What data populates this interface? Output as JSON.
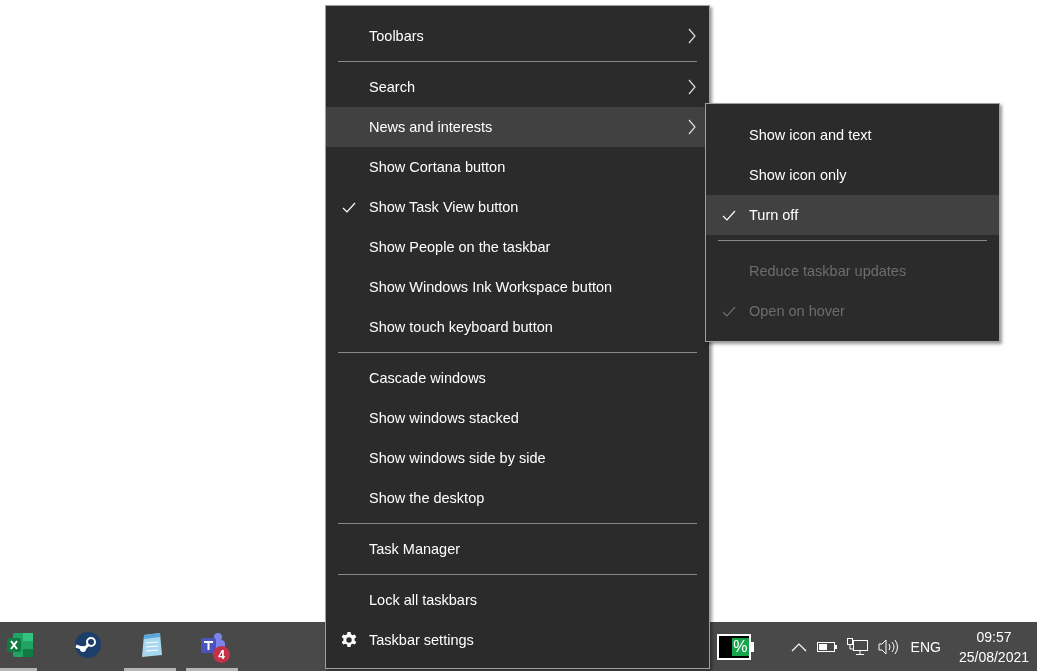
{
  "context_menu": {
    "items": [
      {
        "kind": "item",
        "label": "Toolbars",
        "submenu": true,
        "checked": false,
        "selected": false
      },
      {
        "kind": "separator"
      },
      {
        "kind": "item",
        "label": "Search",
        "submenu": true,
        "checked": false,
        "selected": false
      },
      {
        "kind": "item",
        "label": "News and interests",
        "submenu": true,
        "checked": false,
        "selected": true
      },
      {
        "kind": "item",
        "label": "Show Cortana button",
        "submenu": false,
        "checked": false,
        "selected": false
      },
      {
        "kind": "item",
        "label": "Show Task View button",
        "submenu": false,
        "checked": true,
        "selected": false
      },
      {
        "kind": "item",
        "label": "Show People on the taskbar",
        "submenu": false,
        "checked": false,
        "selected": false
      },
      {
        "kind": "item",
        "label": "Show Windows Ink Workspace button",
        "submenu": false,
        "checked": false,
        "selected": false
      },
      {
        "kind": "item",
        "label": "Show touch keyboard button",
        "submenu": false,
        "checked": false,
        "selected": false
      },
      {
        "kind": "separator"
      },
      {
        "kind": "item",
        "label": "Cascade windows",
        "submenu": false,
        "checked": false,
        "selected": false
      },
      {
        "kind": "item",
        "label": "Show windows stacked",
        "submenu": false,
        "checked": false,
        "selected": false
      },
      {
        "kind": "item",
        "label": "Show windows side by side",
        "submenu": false,
        "checked": false,
        "selected": false
      },
      {
        "kind": "item",
        "label": "Show the desktop",
        "submenu": false,
        "checked": false,
        "selected": false
      },
      {
        "kind": "separator"
      },
      {
        "kind": "item",
        "label": "Task Manager",
        "submenu": false,
        "checked": false,
        "selected": false
      },
      {
        "kind": "separator"
      },
      {
        "kind": "item",
        "label": "Lock all taskbars",
        "submenu": false,
        "checked": false,
        "selected": false
      },
      {
        "kind": "settings",
        "label": "Taskbar settings",
        "submenu": false,
        "selected": false
      }
    ]
  },
  "submenu": {
    "items": [
      {
        "kind": "item",
        "label": "Show icon and text",
        "checked": false,
        "selected": false,
        "disabled": false
      },
      {
        "kind": "item",
        "label": "Show icon only",
        "checked": false,
        "selected": false,
        "disabled": false
      },
      {
        "kind": "item",
        "label": "Turn off",
        "checked": true,
        "selected": true,
        "disabled": false
      },
      {
        "kind": "separator"
      },
      {
        "kind": "item",
        "label": "Reduce taskbar updates",
        "checked": false,
        "selected": false,
        "disabled": true
      },
      {
        "kind": "item",
        "label": "Open on hover",
        "checked": true,
        "selected": false,
        "disabled": true
      }
    ]
  },
  "taskbar": {
    "apps": [
      {
        "kind": "spreadsheet",
        "running": true
      },
      {
        "kind": "steam",
        "running": false
      },
      {
        "kind": "notepad",
        "running": true
      },
      {
        "kind": "teams",
        "running": true,
        "badge": "4"
      }
    ],
    "battery_widget": {
      "text": "%"
    },
    "tray": {
      "language": "ENG",
      "time": "09:57",
      "date": "25/08/2021"
    }
  }
}
